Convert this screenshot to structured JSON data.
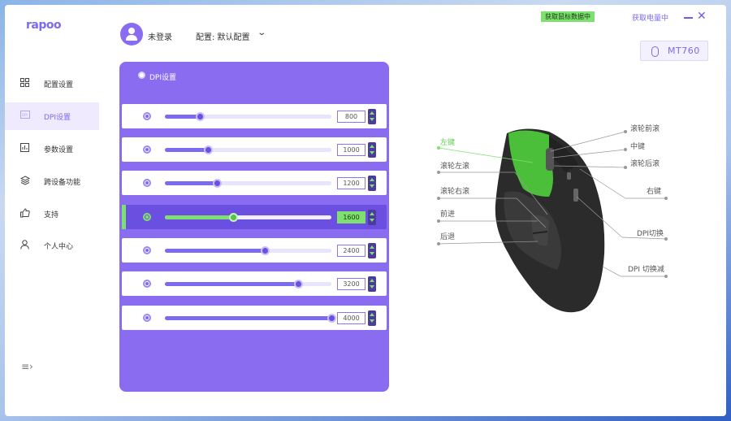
{
  "app": {
    "logo": "rapoo"
  },
  "header": {
    "user_name": "未登录",
    "profile_label": "配置: 默认配置",
    "mouse_status": "获取鼠标数据中",
    "battery_status": "获取电量中",
    "device_model": "MT760"
  },
  "sidebar": {
    "items": [
      {
        "label": "配置设置",
        "icon": "grid-icon"
      },
      {
        "label": "DPI设置",
        "icon": "dpi-icon",
        "active": true
      },
      {
        "label": "参数设置",
        "icon": "chart-icon"
      },
      {
        "label": "跨设备功能",
        "icon": "layers-icon"
      },
      {
        "label": "支持",
        "icon": "thumbs-up-icon"
      },
      {
        "label": "个人中心",
        "icon": "person-icon"
      }
    ]
  },
  "dpi_panel": {
    "title": "DPI设置",
    "levels": [
      {
        "value": "800",
        "fraction": 0.21
      },
      {
        "value": "1000",
        "fraction": 0.26
      },
      {
        "value": "1200",
        "fraction": 0.31
      },
      {
        "value": "1600",
        "fraction": 0.41,
        "active": true
      },
      {
        "value": "2400",
        "fraction": 0.6
      },
      {
        "value": "3200",
        "fraction": 0.8
      },
      {
        "value": "4000",
        "fraction": 1.0
      }
    ]
  },
  "mouse_buttons": {
    "left_click": "左键",
    "wheel_left": "滚轮左滚",
    "wheel_right": "滚轮右滚",
    "forward": "前进",
    "back": "后退",
    "wheel_forward": "滚轮前滚",
    "middle_click": "中键",
    "wheel_back": "滚轮后滚",
    "right_click": "右键",
    "dpi_switch": "DPI切换",
    "dpi_switch_down": "DPI 切换减"
  },
  "colors": {
    "accent": "#8a6cf0",
    "highlight": "#7ee06f"
  }
}
